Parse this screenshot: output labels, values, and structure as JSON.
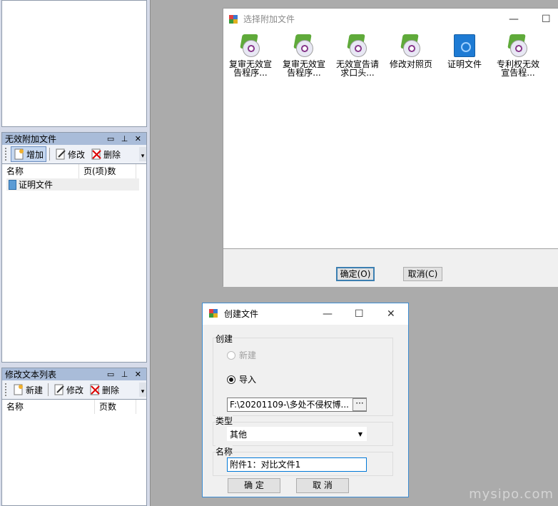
{
  "invalid_panel": {
    "title": "无效附加文件",
    "toolbar": {
      "add": "增加",
      "edit": "修改",
      "delete": "删除"
    },
    "columns": [
      "名称",
      "页(项)数"
    ],
    "rows": [
      {
        "name": "证明文件",
        "pages": ""
      }
    ]
  },
  "modify_panel": {
    "title": "修改文本列表",
    "toolbar": {
      "new": "新建",
      "edit": "修改",
      "delete": "删除"
    },
    "columns": [
      "名称",
      "页数"
    ]
  },
  "select_dialog": {
    "title": "选择附加文件",
    "items": [
      {
        "line1": "复审无效宣",
        "line2": "告程序...",
        "icon": "disc-icon"
      },
      {
        "line1": "复审无效宣",
        "line2": "告程序...",
        "icon": "disc-icon"
      },
      {
        "line1": "无效宣告请",
        "line2": "求口头...",
        "icon": "disc-icon"
      },
      {
        "line1": "修改对照页",
        "line2": "",
        "icon": "disc-icon"
      },
      {
        "line1": "证明文件",
        "line2": "",
        "icon": "book-icon"
      },
      {
        "line1": "专利权无效",
        "line2": "宣告程...",
        "icon": "disc-icon"
      }
    ],
    "ok": "确定(O)",
    "cancel": "取消(C)"
  },
  "create_dialog": {
    "title": "创建文件",
    "group_create": "创建",
    "radio_new": "新建",
    "radio_import": "导入",
    "path_value": "F:\\20201109-\\多处不侵权博...",
    "browse": "···",
    "type_label": "类型",
    "type_value": "其他",
    "name_label": "名称",
    "name_value": "附件1：对比文件1",
    "ok": "确 定",
    "cancel": "取 消"
  },
  "watermark": "mysipo.com"
}
